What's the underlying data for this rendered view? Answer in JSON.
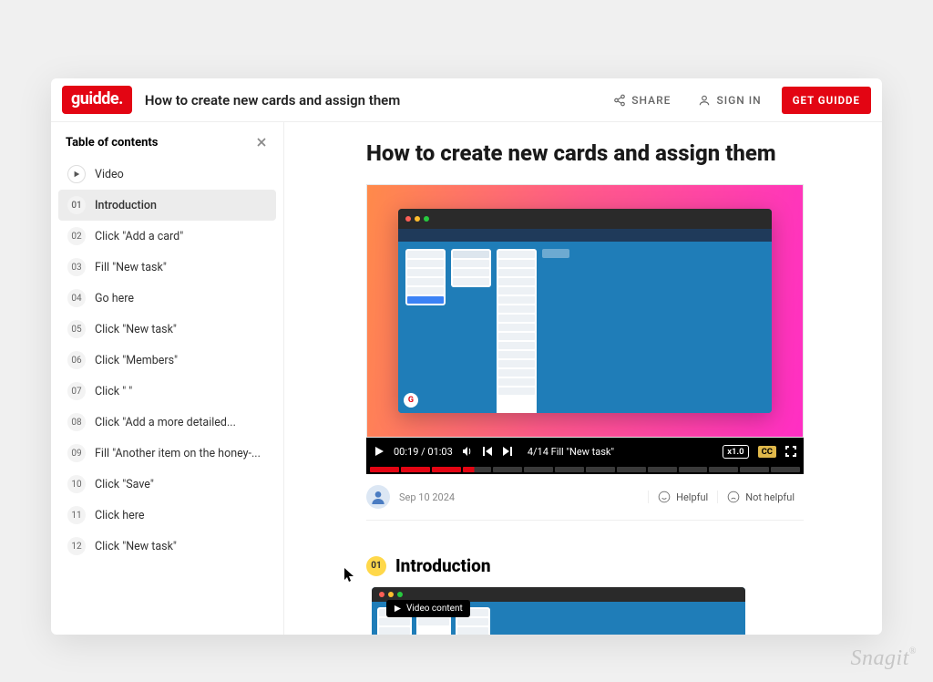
{
  "brand": "guidde.",
  "header": {
    "title": "How to create new cards and assign them",
    "share": "SHARE",
    "signin": "SIGN IN",
    "get": "GET GUIDDE"
  },
  "toc": {
    "title": "Table of contents",
    "video_label": "Video",
    "items": [
      {
        "num": "01",
        "label": "Introduction",
        "selected": true
      },
      {
        "num": "02",
        "label": "Click \"Add a card\""
      },
      {
        "num": "03",
        "label": "Fill \"New task\""
      },
      {
        "num": "04",
        "label": "Go here"
      },
      {
        "num": "05",
        "label": "Click \"New task\""
      },
      {
        "num": "06",
        "label": "Click \"Members\""
      },
      {
        "num": "07",
        "label": "Click \"                     \""
      },
      {
        "num": "08",
        "label": "Click \"Add a more detailed..."
      },
      {
        "num": "09",
        "label": "Fill \"Another item on the honey-..."
      },
      {
        "num": "10",
        "label": "Click \"Save\""
      },
      {
        "num": "11",
        "label": "Click here"
      },
      {
        "num": "12",
        "label": "Click \"New task\""
      }
    ]
  },
  "page": {
    "title": "How to create new cards and assign them"
  },
  "player": {
    "time_current": "00:19",
    "time_total": "01:03",
    "segment_label": "4/14 Fill \"New task\"",
    "rate": "x1.0",
    "cc": "CC",
    "segments_done": 3,
    "segments_total": 14
  },
  "meta": {
    "date": "Sep 10 2024",
    "helpful": "Helpful",
    "not_helpful": "Not helpful"
  },
  "section": {
    "num": "01",
    "title": "Introduction",
    "pill": "Video content"
  },
  "watermark": "Snagit"
}
